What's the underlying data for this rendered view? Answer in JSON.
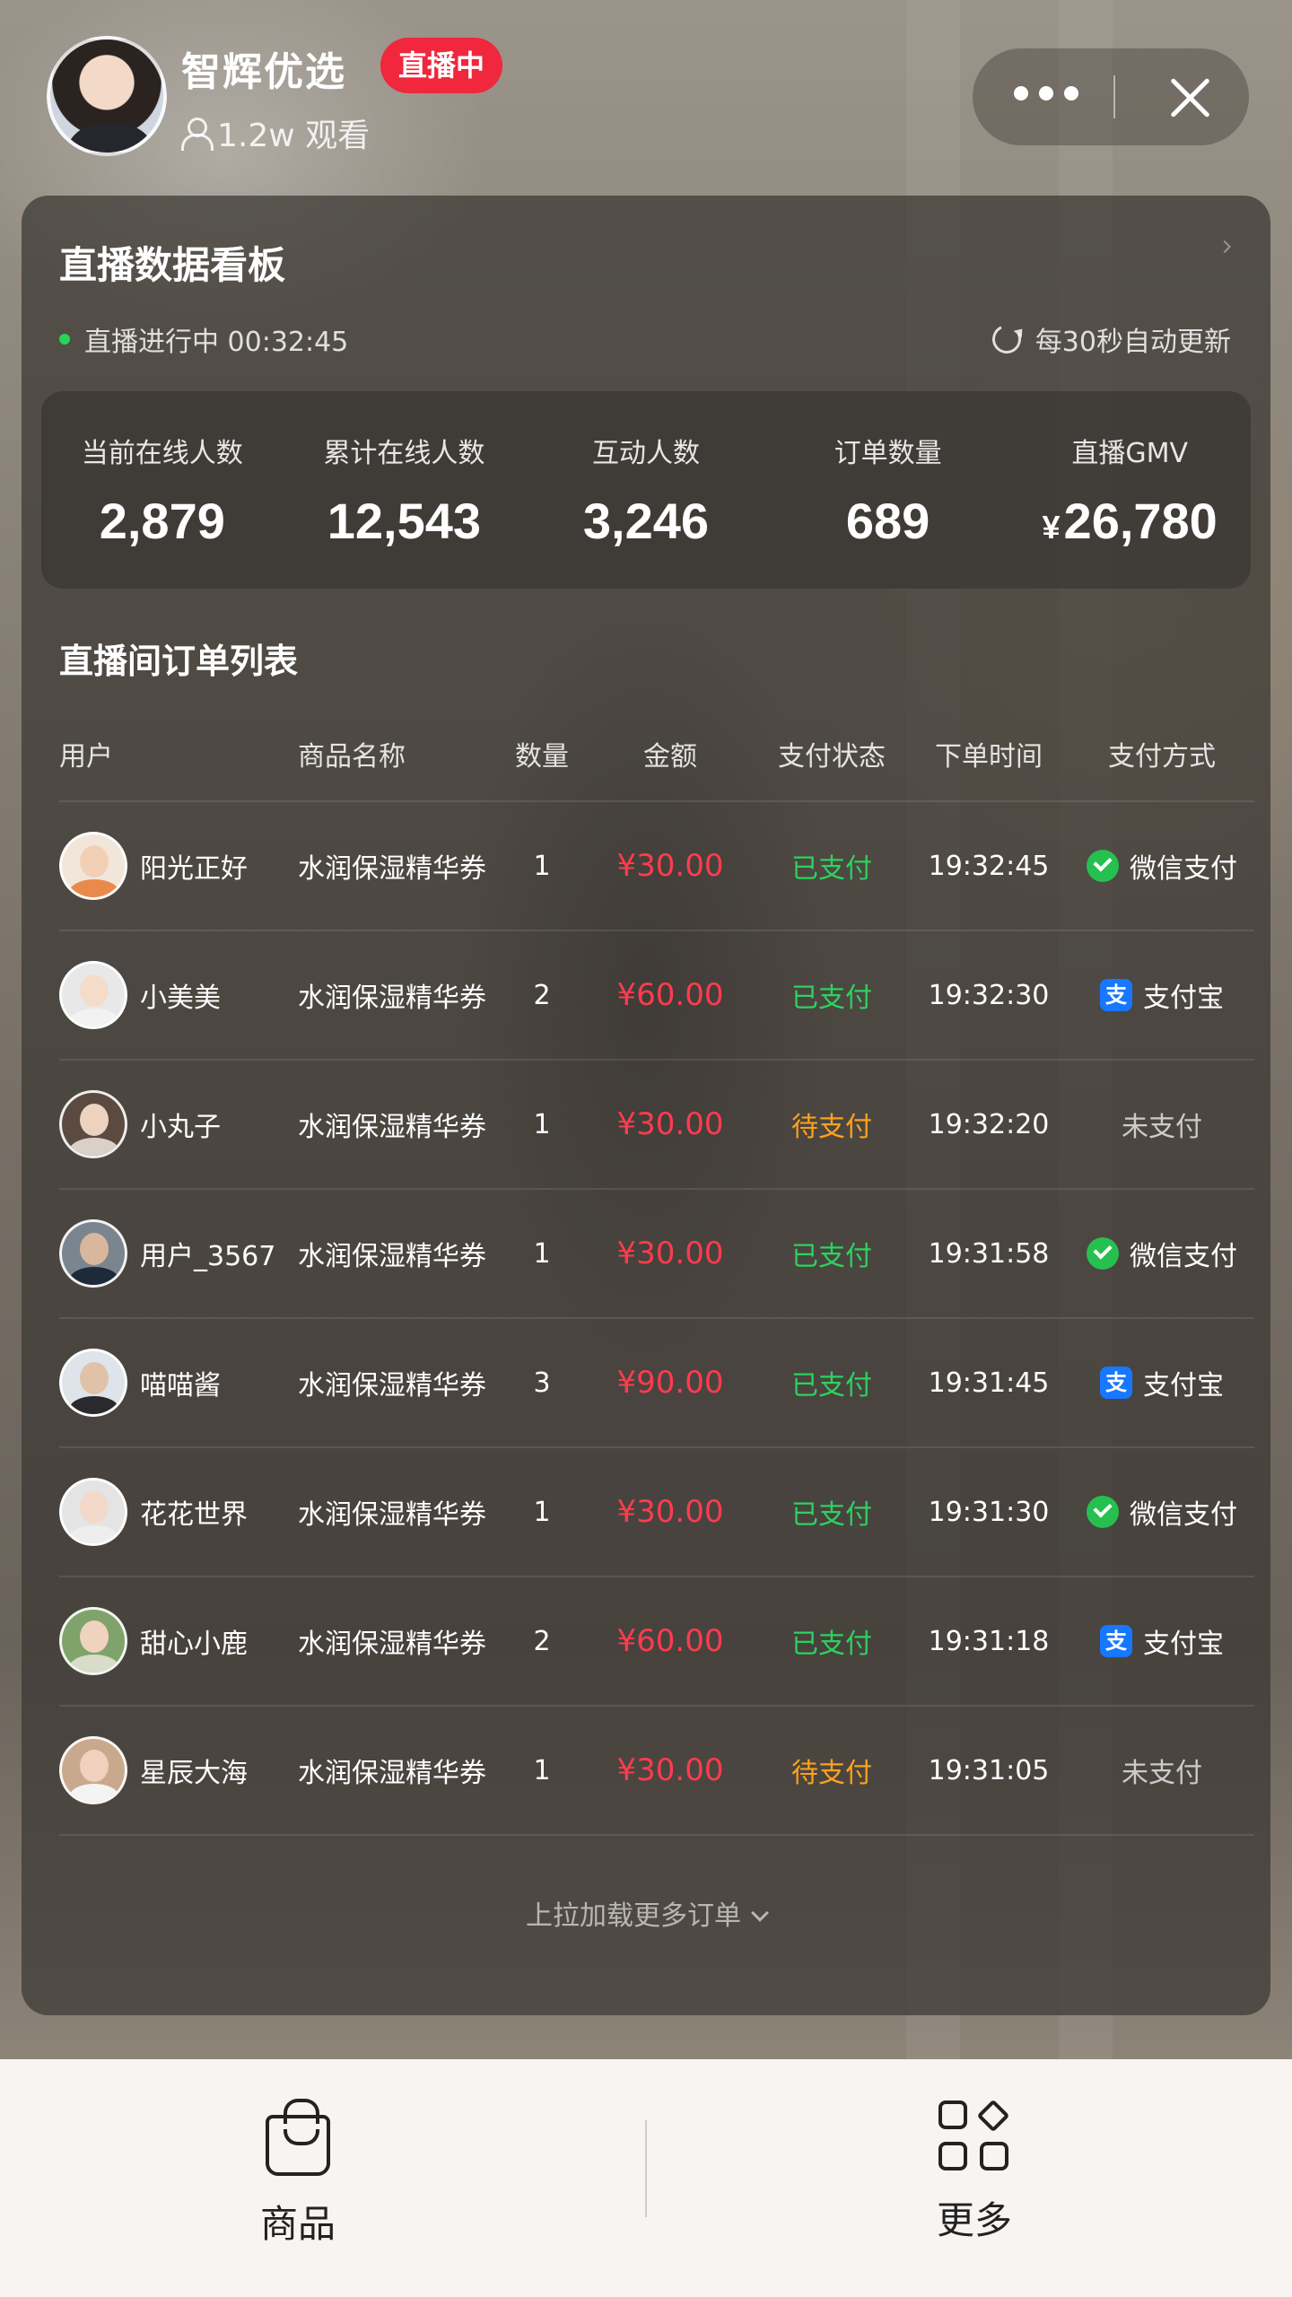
{
  "header": {
    "anchor_name": "智辉优选",
    "live_badge": "直播中",
    "viewers": "1.2w 观看",
    "more_icon": "ellipsis-icon",
    "close_icon": "close-icon"
  },
  "dashboard": {
    "title": "直播数据看板",
    "status_text": "直播进行中 00:32:45",
    "refresh_text": "每30秒自动更新",
    "stats": [
      {
        "label": "当前在线人数",
        "value": "2,879"
      },
      {
        "label": "累计在线人数",
        "value": "12,543"
      },
      {
        "label": "互动人数",
        "value": "3,246"
      },
      {
        "label": "订单数量",
        "value": "689"
      },
      {
        "label": "直播GMV",
        "currency": "¥",
        "value": "26,780"
      }
    ]
  },
  "orders": {
    "title": "直播间订单列表",
    "columns": {
      "user": "用户",
      "product": "商品名称",
      "qty": "数量",
      "amount": "金额",
      "status": "支付状态",
      "time": "下单时间",
      "method": "支付方式"
    },
    "rows": [
      {
        "user": "阳光正好",
        "product": "水润保湿精华券",
        "qty": "1",
        "amount": "¥30.00",
        "status": "已支付",
        "time": "19:32:45",
        "method": "微信支付"
      },
      {
        "user": "小美美",
        "product": "水润保湿精华券",
        "qty": "2",
        "amount": "¥60.00",
        "status": "已支付",
        "time": "19:32:30",
        "method": "支付宝"
      },
      {
        "user": "小丸子",
        "product": "水润保湿精华券",
        "qty": "1",
        "amount": "¥30.00",
        "status": "待支付",
        "time": "19:32:20",
        "method": "未支付"
      },
      {
        "user": "用户_3567",
        "product": "水润保湿精华券",
        "qty": "1",
        "amount": "¥30.00",
        "status": "已支付",
        "time": "19:31:58",
        "method": "微信支付"
      },
      {
        "user": "喵喵酱",
        "product": "水润保湿精华券",
        "qty": "3",
        "amount": "¥90.00",
        "status": "已支付",
        "time": "19:31:45",
        "method": "支付宝"
      },
      {
        "user": "花花世界",
        "product": "水润保湿精华券",
        "qty": "1",
        "amount": "¥30.00",
        "status": "已支付",
        "time": "19:31:30",
        "method": "微信支付"
      },
      {
        "user": "甜心小鹿",
        "product": "水润保湿精华券",
        "qty": "2",
        "amount": "¥60.00",
        "status": "已支付",
        "time": "19:31:18",
        "method": "支付宝"
      },
      {
        "user": "星辰大海",
        "product": "水润保湿精华券",
        "qty": "1",
        "amount": "¥30.00",
        "status": "待支付",
        "time": "19:31:05",
        "method": "未支付"
      }
    ],
    "load_more": "上拉加载更多订单"
  },
  "bottom_bar": {
    "goods_label": "商品",
    "more_label": "更多"
  },
  "colors": {
    "live_red": "#f0273d",
    "amount_red": "#ff3b4e",
    "paid_green": "#2bd35d",
    "pending_orange": "#ffa21a",
    "wechat_green": "#25c04f",
    "alipay_blue": "#1677ff"
  }
}
